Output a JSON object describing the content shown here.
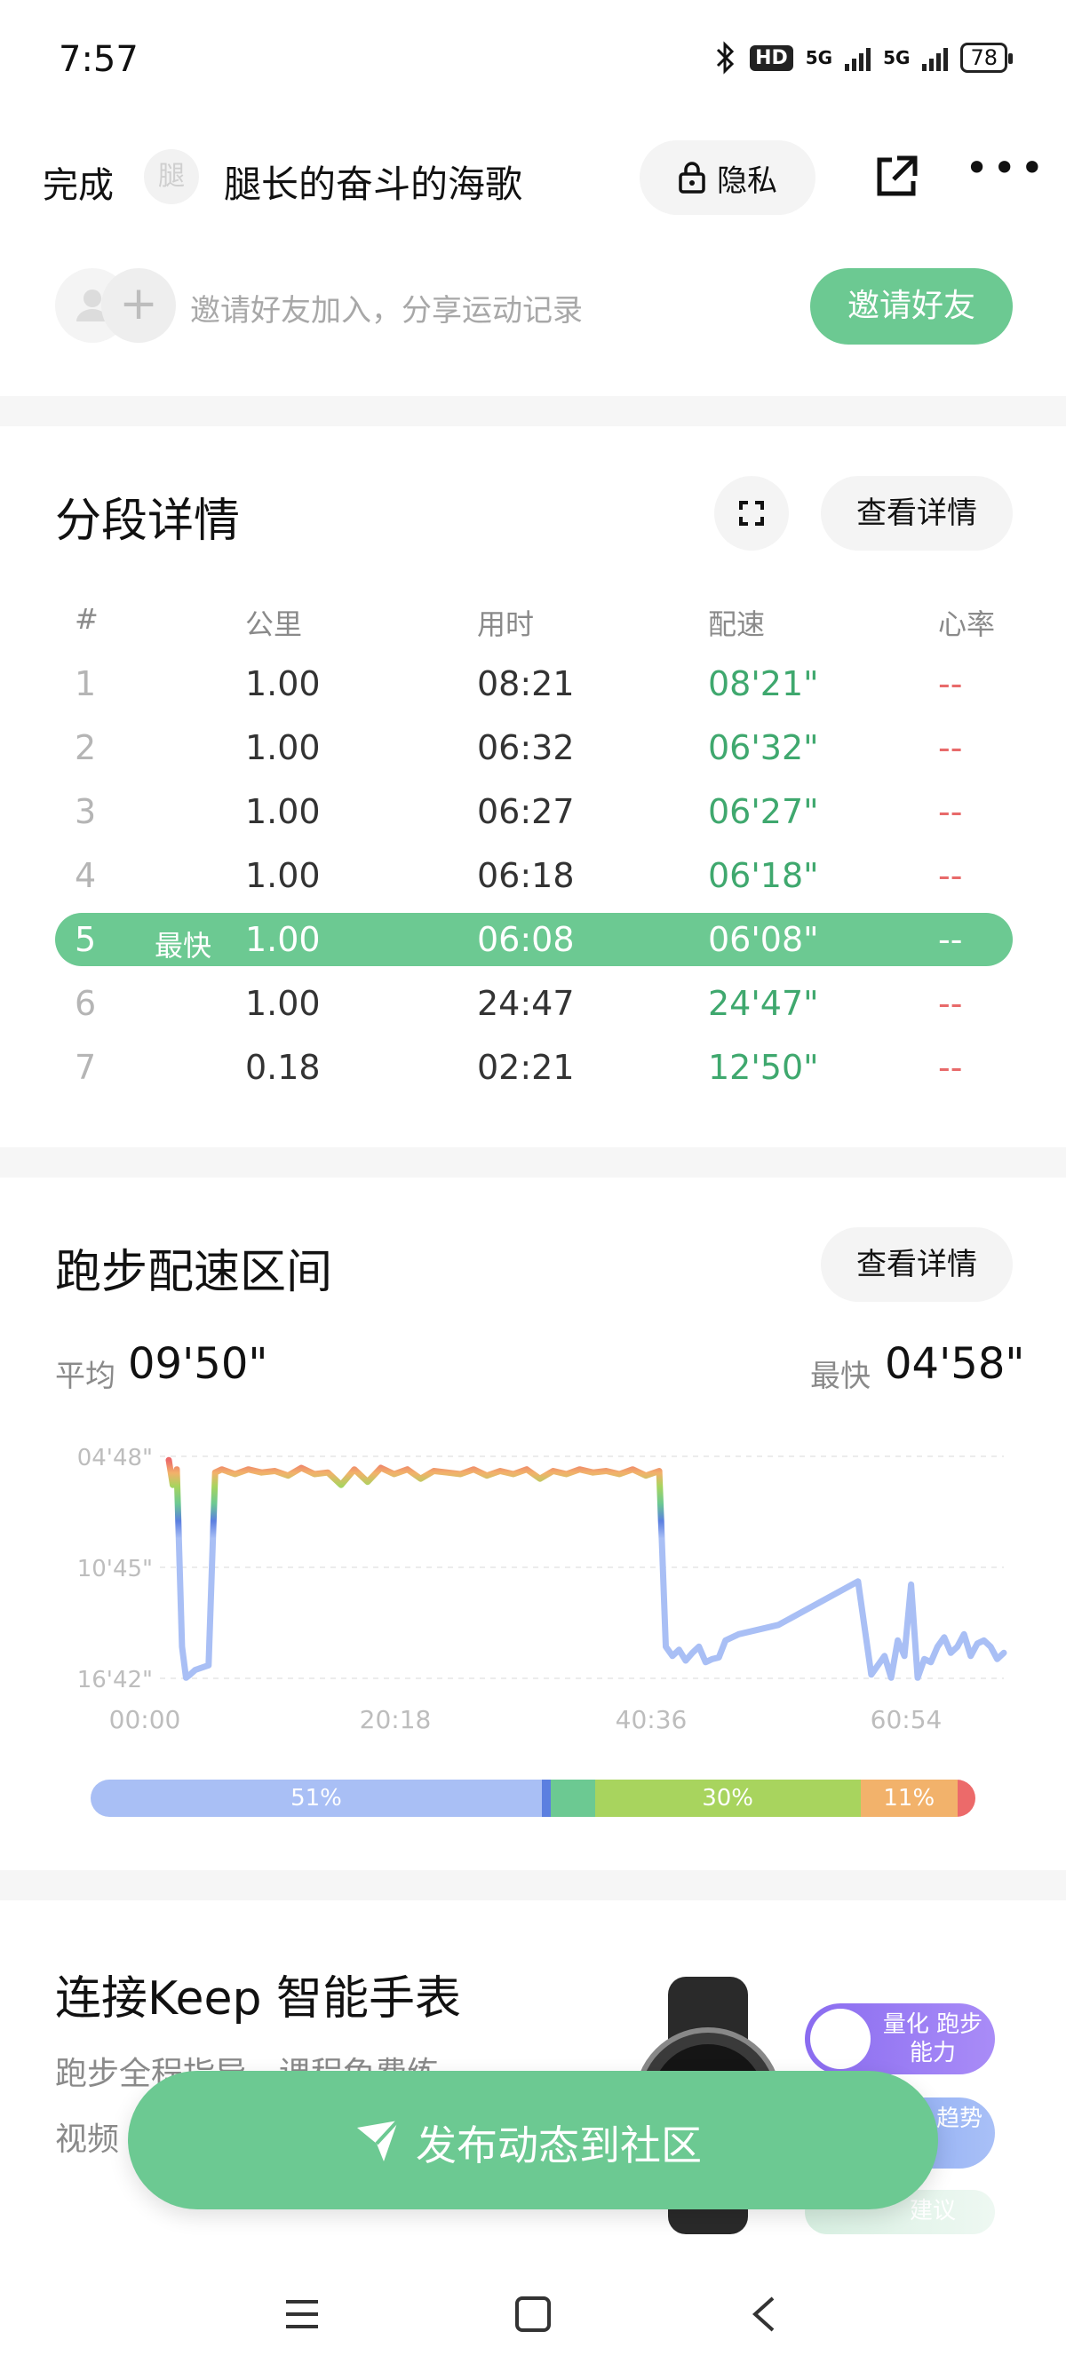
{
  "status_bar": {
    "time": "7:57",
    "hd_label": "HD",
    "net1": "5G",
    "net2": "5G",
    "battery": "78"
  },
  "header": {
    "done_label": "完成",
    "avatar_text": "腿",
    "title": "腿长的奋斗的海歌",
    "privacy_label": "隐私"
  },
  "invite": {
    "text": "邀请好友加入，分享运动记录",
    "button_label": "邀请好友"
  },
  "splits": {
    "title": "分段详情",
    "detail_button": "查看详情",
    "columns": [
      "#",
      "公里",
      "用时",
      "配速",
      "心率"
    ],
    "best_tag": "最快",
    "rows": [
      {
        "idx": "1",
        "km": "1.00",
        "time": "08:21",
        "pace": "08'21\"",
        "hr": "--"
      },
      {
        "idx": "2",
        "km": "1.00",
        "time": "06:32",
        "pace": "06'32\"",
        "hr": "--"
      },
      {
        "idx": "3",
        "km": "1.00",
        "time": "06:27",
        "pace": "06'27\"",
        "hr": "--"
      },
      {
        "idx": "4",
        "km": "1.00",
        "time": "06:18",
        "pace": "06'18\"",
        "hr": "--"
      },
      {
        "idx": "5",
        "km": "1.00",
        "time": "06:08",
        "pace": "06'08\"",
        "hr": "--"
      },
      {
        "idx": "6",
        "km": "1.00",
        "time": "24:47",
        "pace": "24'47\"",
        "hr": "--"
      },
      {
        "idx": "7",
        "km": "0.18",
        "time": "02:21",
        "pace": "12'50\"",
        "hr": "--"
      }
    ]
  },
  "pace": {
    "title": "跑步配速区间",
    "detail_button": "查看详情",
    "avg_label": "平均",
    "avg_value": "09'50\"",
    "fast_label": "最快",
    "fast_value": "04'58\""
  },
  "chart_data": {
    "type": "line",
    "y_ticks": [
      "04'48\"",
      "10'45\"",
      "16'42\""
    ],
    "x_ticks": [
      "00:00",
      "20:18",
      "40:36",
      "60:54"
    ],
    "xlim": [
      0,
      63
    ],
    "ylim_seconds_per_km": [
      288,
      1002
    ],
    "y_inverted": true,
    "grid": true,
    "series_x_minutes": [
      0,
      0.3,
      0.6,
      1.0,
      1.3,
      1.6,
      2,
      3,
      3.5,
      4,
      5,
      6,
      7,
      8,
      9,
      10,
      11,
      12,
      13,
      14,
      15,
      16,
      17,
      18,
      19,
      20,
      21,
      22,
      23,
      24,
      25,
      26,
      27,
      28,
      29,
      30,
      31,
      32,
      33,
      34,
      35,
      36,
      37,
      37.5,
      38,
      38.5,
      39,
      39.5,
      40,
      40.5,
      41,
      41.5,
      42,
      43,
      44,
      45,
      46,
      52,
      53,
      54,
      54.5,
      55,
      55.5,
      56,
      56.5,
      57,
      57.5,
      58,
      58.5,
      59,
      59.5,
      60,
      60.5,
      61,
      61.5,
      62,
      62.5,
      63
    ],
    "series_pace_seconds": [
      300,
      380,
      330,
      900,
      1000,
      990,
      975,
      960,
      340,
      330,
      345,
      330,
      340,
      335,
      350,
      325,
      345,
      340,
      380,
      330,
      370,
      325,
      345,
      330,
      360,
      335,
      340,
      345,
      330,
      350,
      335,
      345,
      330,
      360,
      335,
      345,
      330,
      340,
      335,
      345,
      330,
      350,
      335,
      900,
      930,
      910,
      945,
      920,
      900,
      950,
      940,
      935,
      880,
      860,
      850,
      840,
      830,
      690,
      990,
      930,
      1000,
      880,
      930,
      700,
      1000,
      940,
      950,
      900,
      870,
      920,
      900,
      860,
      930,
      890,
      880,
      900,
      940,
      920
    ],
    "zones": [
      {
        "label": "51%",
        "value": 51,
        "color": "#a9bff5"
      },
      {
        "label": "",
        "value": 1,
        "color": "#5b7fe0"
      },
      {
        "label": "",
        "value": 5,
        "color": "#6cc992"
      },
      {
        "label": "30%",
        "value": 30,
        "color": "#a8d45e"
      },
      {
        "label": "11%",
        "value": 11,
        "color": "#f2b26b"
      },
      {
        "label": "",
        "value": 2,
        "color": "#ec6a6a"
      }
    ]
  },
  "watch": {
    "title": "连接Keep 智能手表",
    "subtitle": "跑步全程指导，课程免费练",
    "subtitle2": "视频",
    "feature1": "量化 跑步能力",
    "feature2": "预测 趋势",
    "feature3": "建议"
  },
  "publish": {
    "label": "发布动态到社区"
  },
  "colors": {
    "accent": "#6cc992",
    "pace_green": "#3fa86e",
    "hr_red": "#e86a6a"
  }
}
